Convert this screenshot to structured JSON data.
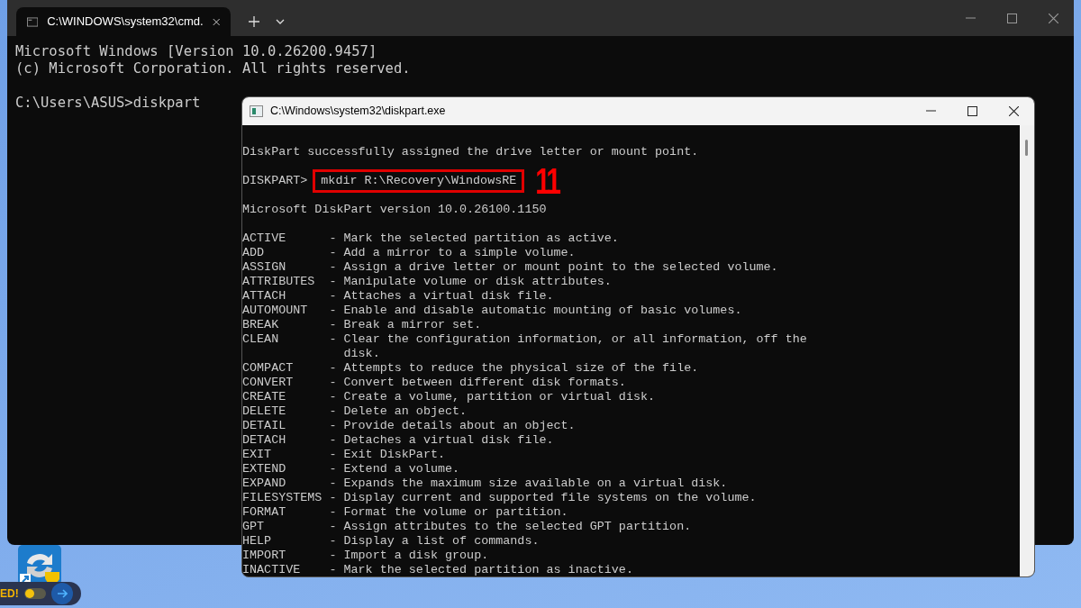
{
  "terminal": {
    "tab_title": "C:\\WINDOWS\\system32\\cmd.",
    "lines": [
      "Microsoft Windows [Version 10.0.26200.9457]",
      "(c) Microsoft Corporation. All rights reserved."
    ],
    "prompt_line": "C:\\Users\\ASUS>diskpart"
  },
  "diskpart": {
    "title": "C:\\Windows\\system32\\diskpart.exe",
    "message": "DiskPart successfully assigned the drive letter or mount point.",
    "prompt": "DISKPART>",
    "command": "mkdir R:\\Recovery\\WindowsRE",
    "step": "11",
    "version": "Microsoft DiskPart version 10.0.26100.1150",
    "commands": [
      {
        "name": "ACTIVE",
        "description": [
          "- Mark the selected partition as active."
        ]
      },
      {
        "name": "ADD",
        "description": [
          "- Add a mirror to a simple volume."
        ]
      },
      {
        "name": "ASSIGN",
        "description": [
          "- Assign a drive letter or mount point to the selected volume."
        ]
      },
      {
        "name": "ATTRIBUTES",
        "description": [
          "- Manipulate volume or disk attributes."
        ]
      },
      {
        "name": "ATTACH",
        "description": [
          "- Attaches a virtual disk file."
        ]
      },
      {
        "name": "AUTOMOUNT",
        "description": [
          "- Enable and disable automatic mounting of basic volumes."
        ]
      },
      {
        "name": "BREAK",
        "description": [
          "- Break a mirror set."
        ]
      },
      {
        "name": "CLEAN",
        "description": [
          "- Clear the configuration information, or all information, off the",
          "disk."
        ]
      },
      {
        "name": "COMPACT",
        "description": [
          "- Attempts to reduce the physical size of the file."
        ]
      },
      {
        "name": "CONVERT",
        "description": [
          "- Convert between different disk formats."
        ]
      },
      {
        "name": "CREATE",
        "description": [
          "- Create a volume, partition or virtual disk."
        ]
      },
      {
        "name": "DELETE",
        "description": [
          "- Delete an object."
        ]
      },
      {
        "name": "DETAIL",
        "description": [
          "- Provide details about an object."
        ]
      },
      {
        "name": "DETACH",
        "description": [
          "- Detaches a virtual disk file."
        ]
      },
      {
        "name": "EXIT",
        "description": [
          "- Exit DiskPart."
        ]
      },
      {
        "name": "EXTEND",
        "description": [
          "- Extend a volume."
        ]
      },
      {
        "name": "EXPAND",
        "description": [
          "- Expands the maximum size available on a virtual disk."
        ]
      },
      {
        "name": "FILESYSTEMS",
        "description": [
          "- Display current and supported file systems on the volume."
        ]
      },
      {
        "name": "FORMAT",
        "description": [
          "- Format the volume or partition."
        ]
      },
      {
        "name": "GPT",
        "description": [
          "- Assign attributes to the selected GPT partition."
        ]
      },
      {
        "name": "HELP",
        "description": [
          "- Display a list of commands."
        ]
      },
      {
        "name": "IMPORT",
        "description": [
          "- Import a disk group."
        ]
      },
      {
        "name": "INACTIVE",
        "description": [
          "- Mark the selected partition as inactive."
        ]
      }
    ]
  },
  "widget": {
    "label": "ED!",
    "toggle_on": false
  }
}
